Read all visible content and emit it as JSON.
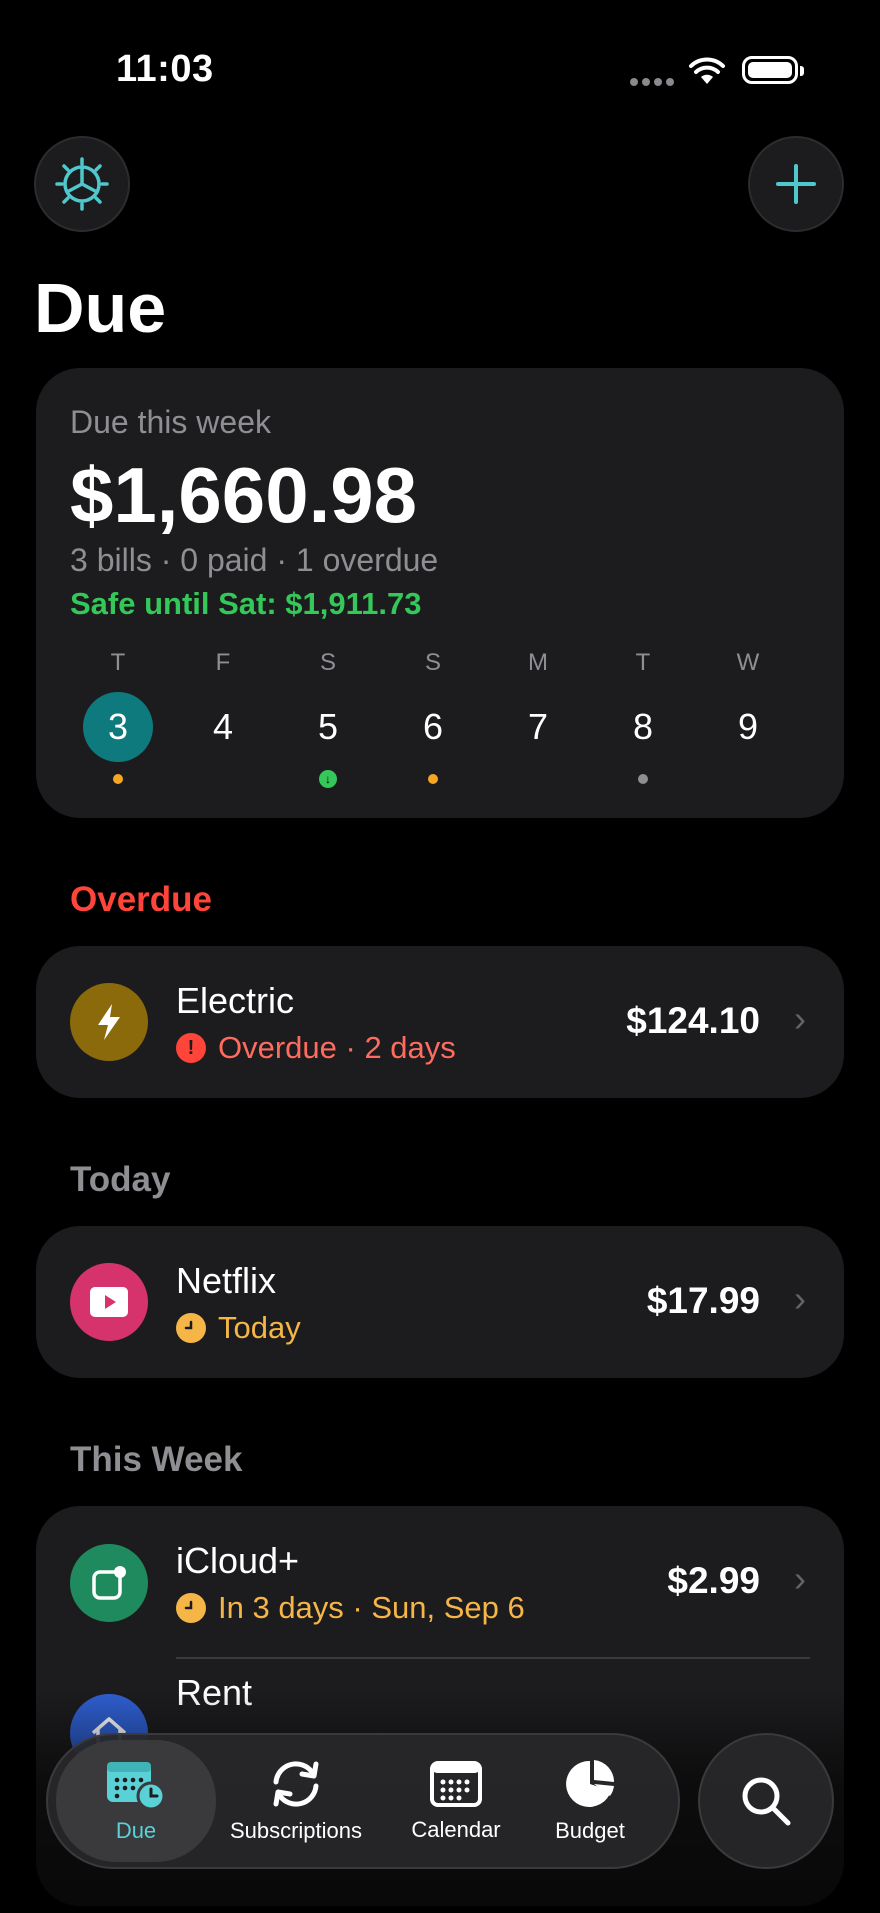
{
  "status": {
    "time": "11:03"
  },
  "header": {
    "title": "Due"
  },
  "summary": {
    "label": "Due this week",
    "amount": "$1,660.98",
    "meta": "3 bills · 0 paid · 1 overdue",
    "safe": "Safe until Sat: $1,911.73",
    "days": [
      {
        "weekday": "T",
        "num": "3",
        "marker": "orange",
        "selected": true
      },
      {
        "weekday": "F",
        "num": "4",
        "marker": "none"
      },
      {
        "weekday": "S",
        "num": "5",
        "marker": "green-down"
      },
      {
        "weekday": "S",
        "num": "6",
        "marker": "orange"
      },
      {
        "weekday": "M",
        "num": "7",
        "marker": "none"
      },
      {
        "weekday": "T",
        "num": "8",
        "marker": "gray"
      },
      {
        "weekday": "W",
        "num": "9",
        "marker": "none"
      }
    ]
  },
  "sections": {
    "overdue": "Overdue",
    "today": "Today",
    "this_week": "This Week"
  },
  "bills": {
    "electric": {
      "name": "Electric",
      "status": "Overdue · 2 days",
      "amount": "$124.10",
      "icon": "bolt-icon",
      "color": "#8a6a0a"
    },
    "netflix": {
      "name": "Netflix",
      "status": "Today",
      "amount": "$17.99",
      "icon": "play-icon",
      "color": "#d6336c"
    },
    "icloud": {
      "name": "iCloud+",
      "status": "In 3 days · Sun, Sep 6",
      "amount": "$2.99",
      "icon": "app-badge-icon",
      "color": "#1f8a5e"
    },
    "rent": {
      "name": "Rent",
      "icon": "house-icon",
      "color": "#2f5fd0"
    }
  },
  "tabs": [
    {
      "label": "Due",
      "icon": "calendar-clock-icon",
      "selected": true
    },
    {
      "label": "Subscriptions",
      "icon": "refresh-icon"
    },
    {
      "label": "Calendar",
      "icon": "calendar-icon"
    },
    {
      "label": "Budget",
      "icon": "pie-chart-icon"
    }
  ],
  "colors": {
    "accent": "#5ad1d6",
    "overdue": "#ff453a",
    "warning": "#f5b547",
    "safe": "#34c759"
  }
}
